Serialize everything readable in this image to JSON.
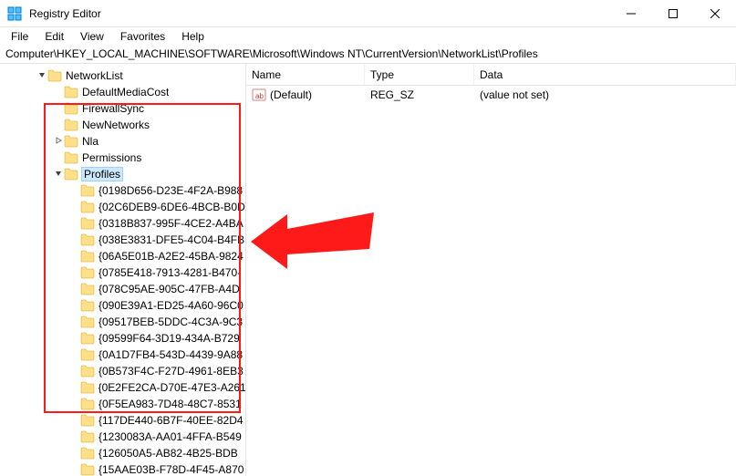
{
  "window": {
    "title": "Registry Editor"
  },
  "menubar": {
    "file": "File",
    "edit": "Edit",
    "view": "View",
    "favorites": "Favorites",
    "help": "Help"
  },
  "addressbar": {
    "path": "Computer\\HKEY_LOCAL_MACHINE\\SOFTWARE\\Microsoft\\Windows NT\\CurrentVersion\\NetworkList\\Profiles"
  },
  "tree": {
    "parent": "NetworkList",
    "siblings": [
      "DefaultMediaCost",
      "FirewallSync",
      "NewNetworks",
      "Nla",
      "Permissions"
    ],
    "selected": "Profiles",
    "children": [
      "{0198D656-D23E-4F2A-B988",
      "{02C6DEB9-6DE6-4BCB-B0D",
      "{0318B837-995F-4CE2-A4BA",
      "{038E3831-DFE5-4C04-B4FB",
      "{06A5E01B-A2E2-45BA-9824",
      "{0785E418-7913-4281-B470-",
      "{078C95AE-905C-47FB-A4D",
      "{090E39A1-ED25-4A60-96C0",
      "{09517BEB-5DDC-4C3A-9C3",
      "{09599F64-3D19-434A-B729",
      "{0A1D7FB4-543D-4439-9A88",
      "{0B573F4C-F27D-4961-8EB3",
      "{0E2FE2CA-D70E-47E3-A261",
      "{0F5EA983-7D48-48C7-8531",
      "{117DE440-6B7F-40EE-82D4",
      "{1230083A-AA01-4FFA-B549",
      "{126050A5-AB82-4B25-BDB",
      "{15AAE03B-F78D-4F45-A870"
    ]
  },
  "list": {
    "headers": {
      "name": "Name",
      "type": "Type",
      "data": "Data"
    },
    "rows": [
      {
        "name": "(Default)",
        "type": "REG_SZ",
        "data": "(value not set)"
      }
    ]
  }
}
